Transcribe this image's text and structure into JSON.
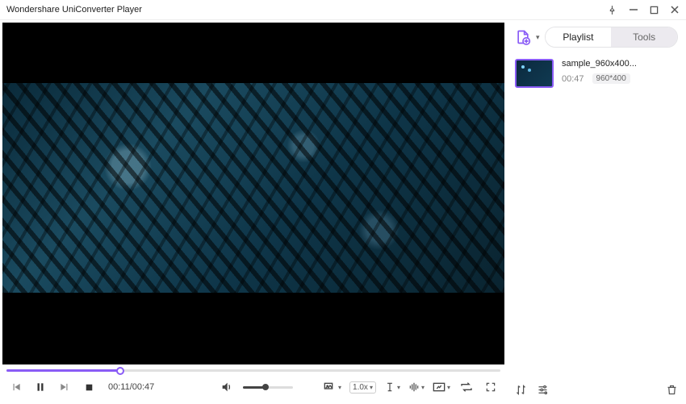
{
  "window": {
    "title": "Wondershare UniConverter Player"
  },
  "player": {
    "elapsed": "00:11",
    "duration": "00:47",
    "time_display": "00:11/00:47",
    "progress_pct": 23,
    "volume_pct": 45,
    "speed_label": "1.0x"
  },
  "sidebar": {
    "tabs": {
      "playlist": "Playlist",
      "tools": "Tools",
      "active": "playlist"
    },
    "items": [
      {
        "name": "sample_960x400...",
        "duration": "00:47",
        "resolution": "960*400"
      }
    ]
  },
  "colors": {
    "accent": "#8a5cf6"
  }
}
